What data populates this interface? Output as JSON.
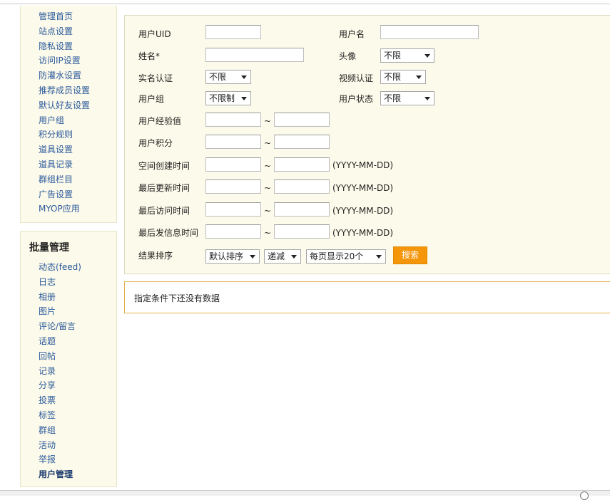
{
  "sidebar_settings": {
    "items": [
      "管理首页",
      "站点设置",
      "隐私设置",
      "访问IP设置",
      "防灌水设置",
      "推荐成员设置",
      "默认好友设置",
      "用户组",
      "积分规则",
      "道具设置",
      "道具记录",
      "群组栏目",
      "广告设置",
      "MYOP应用"
    ]
  },
  "sidebar_batch": {
    "title": "批量管理",
    "items": [
      "动态(feed)",
      "日志",
      "相册",
      "图片",
      "评论/留言",
      "话题",
      "回帖",
      "记录",
      "分享",
      "投票",
      "标签",
      "群组",
      "活动",
      "举报",
      "用户管理"
    ],
    "active_index": 14
  },
  "form": {
    "uid_label": "用户UID",
    "username_label": "用户名",
    "name_label": "姓名*",
    "avatar_label": "头像",
    "avatar_value": "不限",
    "realname_label": "实名认证",
    "realname_value": "不限",
    "video_label": "视频认证",
    "video_value": "不限",
    "group_label": "用户组",
    "group_value": "不限制",
    "status_label": "用户状态",
    "status_value": "不限",
    "exp_label": "用户经验值",
    "credit_label": "用户积分",
    "space_created_label": "空间创建时间",
    "last_update_label": "最后更新时间",
    "last_visit_label": "最后访问时间",
    "last_post_label": "最后发信息时间",
    "range_sep": "~",
    "date_hint": "(YYYY-MM-DD)",
    "sort_label": "结果排序",
    "sort_value": "默认排序",
    "order_value": "递减",
    "perpage_value": "每页显示20个",
    "search_button": "搜索"
  },
  "result": {
    "empty_text": "指定条件下还没有数据"
  }
}
